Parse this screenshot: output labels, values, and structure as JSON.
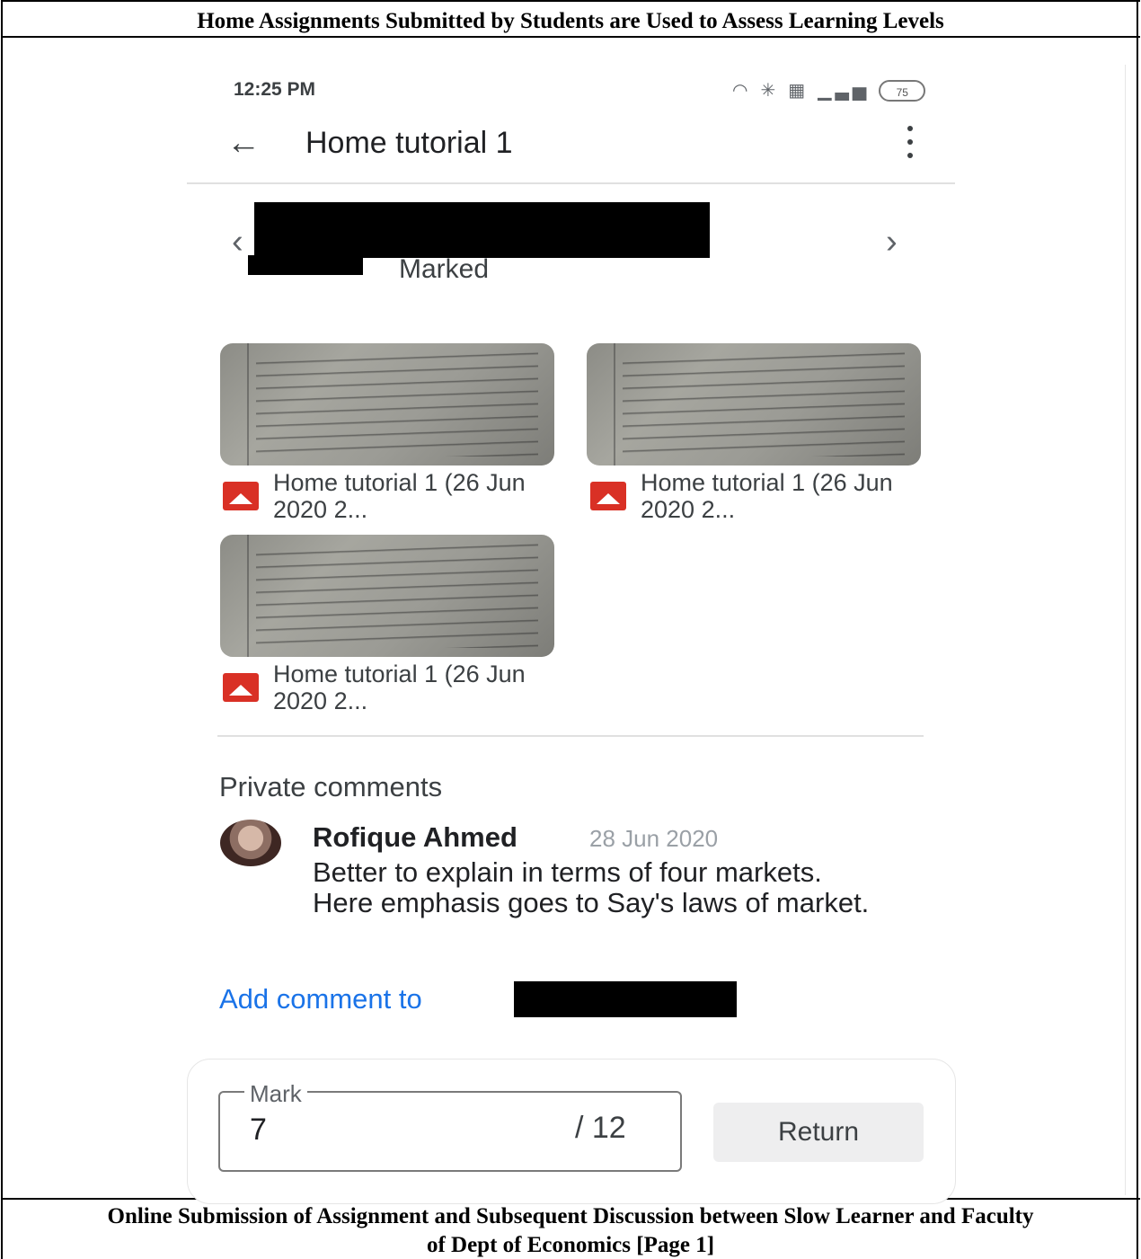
{
  "document": {
    "heading": "Home Assignments Submitted by Students are Used to Assess Learning Levels",
    "caption_line1": "Online Submission of Assignment and Subsequent Discussion between Slow Learner and Faculty",
    "caption_line2": "of Dept of Economics [Page 1]"
  },
  "status_bar": {
    "time": "12:25 PM",
    "battery": "75",
    "icons": [
      "wifi-icon",
      "bluetooth-icon",
      "data-saver-icon",
      "signal-icon",
      "battery-icon"
    ]
  },
  "app_bar": {
    "title": "Home tutorial 1"
  },
  "student": {
    "status": "Marked"
  },
  "attachments": [
    {
      "name": "Home tutorial 1 (26 Jun 2020 2...",
      "icon": "image-file-icon"
    },
    {
      "name": "Home tutorial 1 (26 Jun 2020 2...",
      "icon": "image-file-icon"
    },
    {
      "name": "Home tutorial 1 (26 Jun 2020 2...",
      "icon": "image-file-icon"
    }
  ],
  "comments": {
    "section_title": "Private comments",
    "items": [
      {
        "author": "Rofique Ahmed",
        "date": "28 Jun 2020",
        "text": "Better to explain in terms of four markets. Here emphasis goes to Say's laws of market."
      }
    ],
    "add_comment_label": "Add comment to"
  },
  "grading": {
    "field_label": "Mark",
    "value": "7",
    "total": "/ 12",
    "return_label": "Return"
  },
  "colors": {
    "accent_link": "#1a73e8",
    "file_icon": "#d93025",
    "button_bg": "#eeeeef"
  }
}
